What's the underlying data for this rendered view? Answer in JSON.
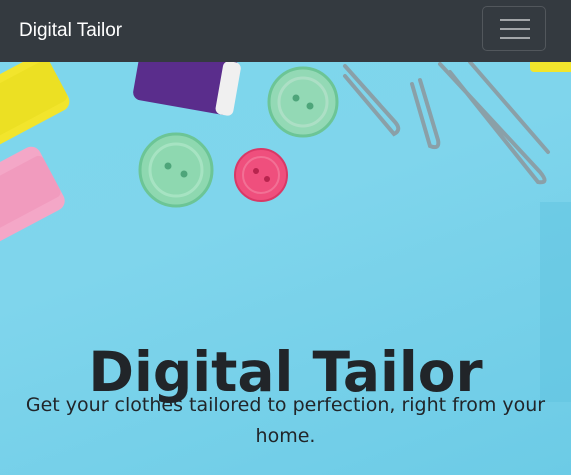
{
  "navbar": {
    "brand": "Digital Tailor",
    "toggler_icon": "hamburger-menu-icon"
  },
  "hero": {
    "title": "Digital Tailor",
    "subtitle": "Get your clothes tailored to perfection, right from your home.",
    "background_color": "#7ed6ec"
  },
  "colors": {
    "navbar_bg": "#343a40",
    "text_dark": "#212529",
    "brand_text": "#ffffff"
  }
}
